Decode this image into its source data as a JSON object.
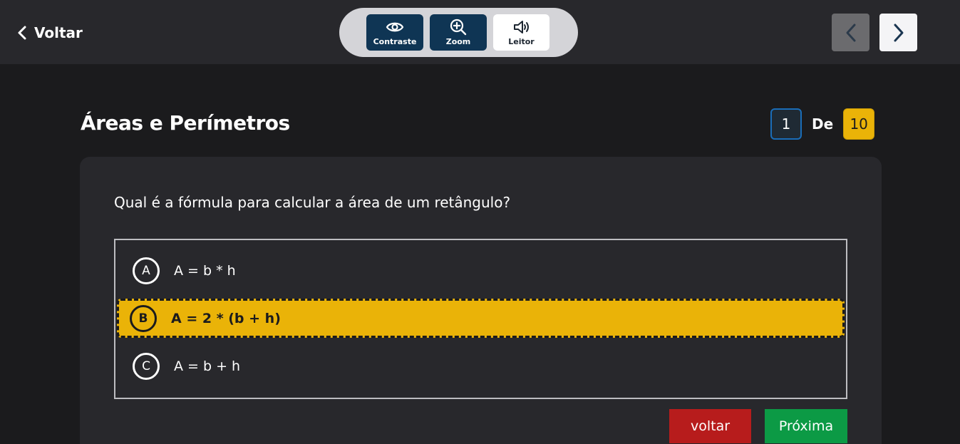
{
  "header": {
    "back_label": "Voltar",
    "tools": [
      {
        "label": "Contraste",
        "icon": "eye-icon"
      },
      {
        "label": "Zoom",
        "icon": "zoom-in-icon"
      },
      {
        "label": "Leitor",
        "icon": "speaker-icon"
      }
    ],
    "nav": {
      "prev_icon": "chevron-left-icon",
      "next_icon": "chevron-right-icon"
    }
  },
  "quiz": {
    "title": "Áreas e Perímetros",
    "current": "1",
    "separator": "De",
    "total": "10"
  },
  "question": {
    "text": "Qual é a fórmula para calcular a área de um retângulo?",
    "options": [
      {
        "letter": "A",
        "text": "A = b * h",
        "selected": false
      },
      {
        "letter": "B",
        "text": "A = 2 * (b + h)",
        "selected": true
      },
      {
        "letter": "C",
        "text": "A = b + h",
        "selected": false
      }
    ]
  },
  "actions": {
    "back_label": "voltar",
    "next_label": "Próxima"
  },
  "colors": {
    "accent_yellow": "#eab308",
    "tool_dark": "#0f3554",
    "back_red": "#b71c1c",
    "next_green": "#0c9a45"
  }
}
